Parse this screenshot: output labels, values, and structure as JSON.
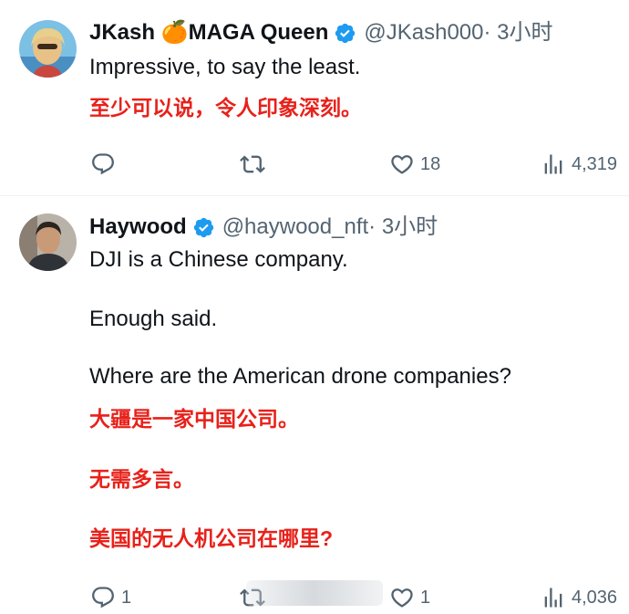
{
  "tweets": [
    {
      "name": "JKash 🍊MAGA Queen",
      "handle": "@JKash000",
      "time": "· 3小时",
      "text": [
        "Impressive, to say the least."
      ],
      "translation": [
        "至少可以说，令人印象深刻。"
      ],
      "replies": "",
      "retweets": "",
      "likes": "18",
      "views": "4,319"
    },
    {
      "name": "Haywood",
      "handle": "@haywood_nft",
      "time": "· 3小时",
      "text": [
        "DJI is a Chinese company.",
        "Enough said.",
        "Where are the American drone companies?"
      ],
      "translation": [
        "大疆是一家中国公司。",
        "无需多言。",
        "美国的无人机公司在哪里?"
      ],
      "replies": "1",
      "retweets": "",
      "likes": "1",
      "views": "4,036"
    }
  ],
  "colors": {
    "verified": "#1d9bf0",
    "translation": "#e8211a",
    "secondary": "#536471",
    "text": "#0f1419"
  },
  "icons": [
    "reply-icon",
    "retweet-icon",
    "like-icon",
    "views-icon",
    "verified-badge-icon"
  ]
}
